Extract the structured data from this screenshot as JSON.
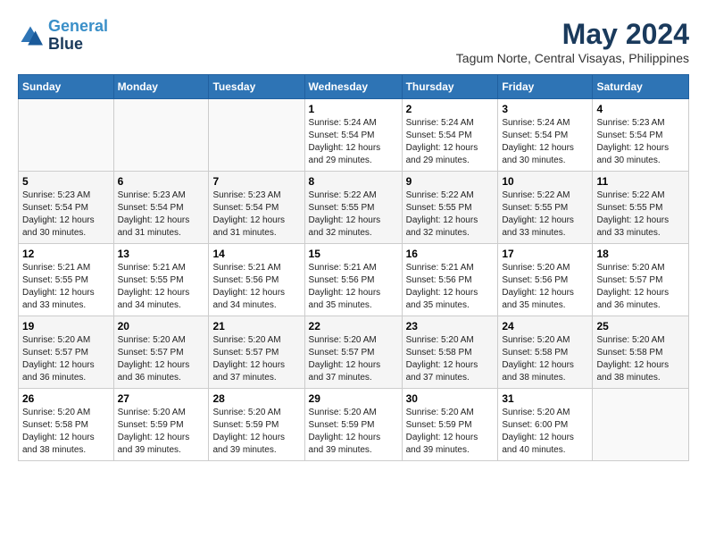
{
  "header": {
    "logo_line1": "General",
    "logo_line2": "Blue",
    "main_title": "May 2024",
    "subtitle": "Tagum Norte, Central Visayas, Philippines"
  },
  "days_of_week": [
    "Sunday",
    "Monday",
    "Tuesday",
    "Wednesday",
    "Thursday",
    "Friday",
    "Saturday"
  ],
  "weeks": [
    [
      {
        "day": "",
        "info": ""
      },
      {
        "day": "",
        "info": ""
      },
      {
        "day": "",
        "info": ""
      },
      {
        "day": "1",
        "info": "Sunrise: 5:24 AM\nSunset: 5:54 PM\nDaylight: 12 hours\nand 29 minutes."
      },
      {
        "day": "2",
        "info": "Sunrise: 5:24 AM\nSunset: 5:54 PM\nDaylight: 12 hours\nand 29 minutes."
      },
      {
        "day": "3",
        "info": "Sunrise: 5:24 AM\nSunset: 5:54 PM\nDaylight: 12 hours\nand 30 minutes."
      },
      {
        "day": "4",
        "info": "Sunrise: 5:23 AM\nSunset: 5:54 PM\nDaylight: 12 hours\nand 30 minutes."
      }
    ],
    [
      {
        "day": "5",
        "info": "Sunrise: 5:23 AM\nSunset: 5:54 PM\nDaylight: 12 hours\nand 30 minutes."
      },
      {
        "day": "6",
        "info": "Sunrise: 5:23 AM\nSunset: 5:54 PM\nDaylight: 12 hours\nand 31 minutes."
      },
      {
        "day": "7",
        "info": "Sunrise: 5:23 AM\nSunset: 5:54 PM\nDaylight: 12 hours\nand 31 minutes."
      },
      {
        "day": "8",
        "info": "Sunrise: 5:22 AM\nSunset: 5:55 PM\nDaylight: 12 hours\nand 32 minutes."
      },
      {
        "day": "9",
        "info": "Sunrise: 5:22 AM\nSunset: 5:55 PM\nDaylight: 12 hours\nand 32 minutes."
      },
      {
        "day": "10",
        "info": "Sunrise: 5:22 AM\nSunset: 5:55 PM\nDaylight: 12 hours\nand 33 minutes."
      },
      {
        "day": "11",
        "info": "Sunrise: 5:22 AM\nSunset: 5:55 PM\nDaylight: 12 hours\nand 33 minutes."
      }
    ],
    [
      {
        "day": "12",
        "info": "Sunrise: 5:21 AM\nSunset: 5:55 PM\nDaylight: 12 hours\nand 33 minutes."
      },
      {
        "day": "13",
        "info": "Sunrise: 5:21 AM\nSunset: 5:55 PM\nDaylight: 12 hours\nand 34 minutes."
      },
      {
        "day": "14",
        "info": "Sunrise: 5:21 AM\nSunset: 5:56 PM\nDaylight: 12 hours\nand 34 minutes."
      },
      {
        "day": "15",
        "info": "Sunrise: 5:21 AM\nSunset: 5:56 PM\nDaylight: 12 hours\nand 35 minutes."
      },
      {
        "day": "16",
        "info": "Sunrise: 5:21 AM\nSunset: 5:56 PM\nDaylight: 12 hours\nand 35 minutes."
      },
      {
        "day": "17",
        "info": "Sunrise: 5:20 AM\nSunset: 5:56 PM\nDaylight: 12 hours\nand 35 minutes."
      },
      {
        "day": "18",
        "info": "Sunrise: 5:20 AM\nSunset: 5:57 PM\nDaylight: 12 hours\nand 36 minutes."
      }
    ],
    [
      {
        "day": "19",
        "info": "Sunrise: 5:20 AM\nSunset: 5:57 PM\nDaylight: 12 hours\nand 36 minutes."
      },
      {
        "day": "20",
        "info": "Sunrise: 5:20 AM\nSunset: 5:57 PM\nDaylight: 12 hours\nand 36 minutes."
      },
      {
        "day": "21",
        "info": "Sunrise: 5:20 AM\nSunset: 5:57 PM\nDaylight: 12 hours\nand 37 minutes."
      },
      {
        "day": "22",
        "info": "Sunrise: 5:20 AM\nSunset: 5:57 PM\nDaylight: 12 hours\nand 37 minutes."
      },
      {
        "day": "23",
        "info": "Sunrise: 5:20 AM\nSunset: 5:58 PM\nDaylight: 12 hours\nand 37 minutes."
      },
      {
        "day": "24",
        "info": "Sunrise: 5:20 AM\nSunset: 5:58 PM\nDaylight: 12 hours\nand 38 minutes."
      },
      {
        "day": "25",
        "info": "Sunrise: 5:20 AM\nSunset: 5:58 PM\nDaylight: 12 hours\nand 38 minutes."
      }
    ],
    [
      {
        "day": "26",
        "info": "Sunrise: 5:20 AM\nSunset: 5:58 PM\nDaylight: 12 hours\nand 38 minutes."
      },
      {
        "day": "27",
        "info": "Sunrise: 5:20 AM\nSunset: 5:59 PM\nDaylight: 12 hours\nand 39 minutes."
      },
      {
        "day": "28",
        "info": "Sunrise: 5:20 AM\nSunset: 5:59 PM\nDaylight: 12 hours\nand 39 minutes."
      },
      {
        "day": "29",
        "info": "Sunrise: 5:20 AM\nSunset: 5:59 PM\nDaylight: 12 hours\nand 39 minutes."
      },
      {
        "day": "30",
        "info": "Sunrise: 5:20 AM\nSunset: 5:59 PM\nDaylight: 12 hours\nand 39 minutes."
      },
      {
        "day": "31",
        "info": "Sunrise: 5:20 AM\nSunset: 6:00 PM\nDaylight: 12 hours\nand 40 minutes."
      },
      {
        "day": "",
        "info": ""
      }
    ]
  ]
}
